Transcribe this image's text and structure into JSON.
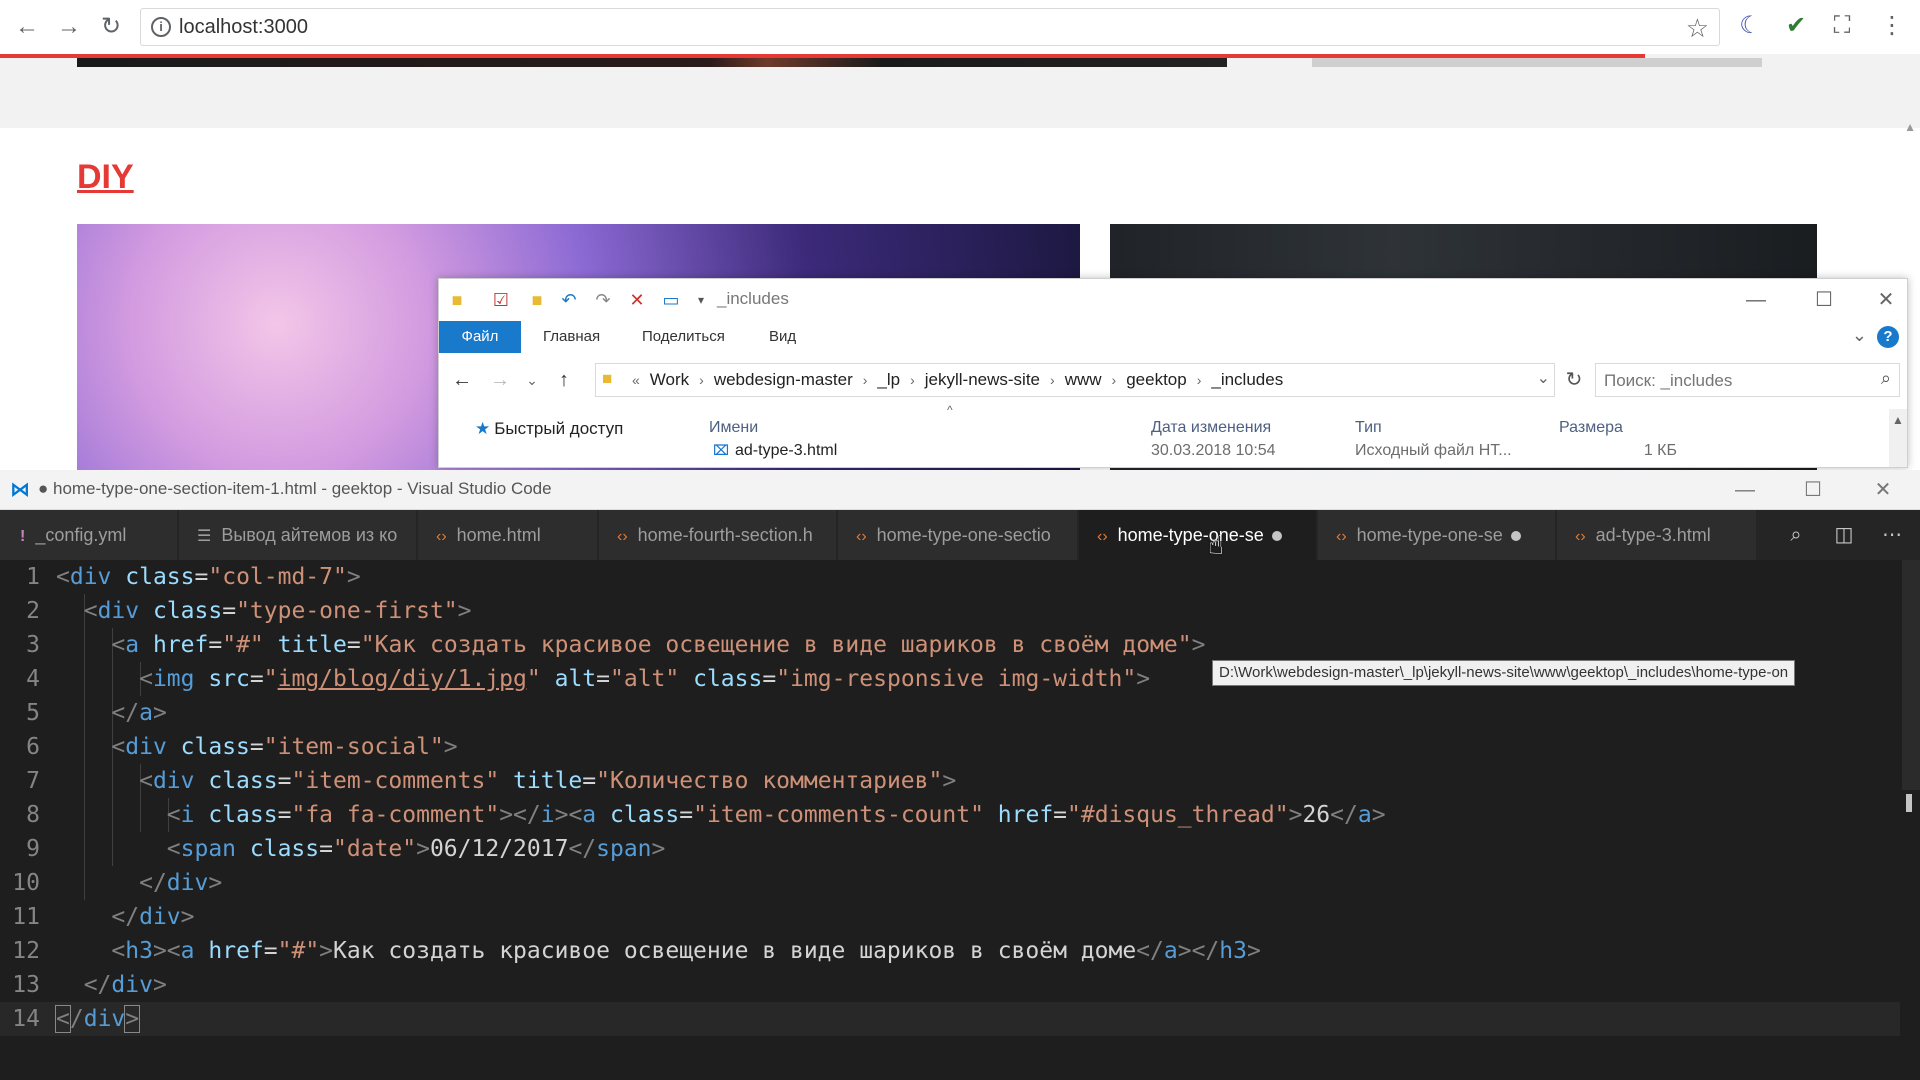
{
  "browser": {
    "url": "localhost:3000",
    "nav": {
      "back": "←",
      "forward": "→",
      "reload": "↻"
    },
    "info_icon": "i",
    "star_icon": "☆",
    "extensions": [
      "moon-icon",
      "vue-icon",
      "fullscreen-icon",
      "menu-icon"
    ],
    "page": {
      "section_title": "DIY"
    },
    "colors": {
      "accent": "#e53935"
    }
  },
  "explorer": {
    "title": "_includes",
    "ribbon_tabs": [
      "Файл",
      "Главная",
      "Поделиться",
      "Вид"
    ],
    "breadcrumbs": [
      "Work",
      "webdesign-master",
      "_lp",
      "jekyll-news-site",
      "www",
      "geektop",
      "_includes"
    ],
    "search_placeholder": "Поиск: _includes",
    "nav_item": "Быстрый доступ",
    "columns": [
      "Имени",
      "Дата изменения",
      "Тип",
      "Размера"
    ],
    "rows": [
      {
        "name": "ad-type-3.html",
        "modified": "30.03.2018 10:54",
        "type": "Исходный файл НТ...",
        "size": "1 КБ"
      }
    ],
    "colors": {
      "accent": "#1979ca"
    }
  },
  "vscode": {
    "title": "● home-type-one-section-item-1.html - geektop - Visual Studio Code",
    "tabs": [
      {
        "label": "_config.yml",
        "icon": "yaml-icon",
        "active": false,
        "dirty": false
      },
      {
        "label": "Вывод айтемов из ко",
        "icon": "markdown-icon",
        "active": false,
        "dirty": false
      },
      {
        "label": "home.html",
        "icon": "html-icon",
        "active": false,
        "dirty": false
      },
      {
        "label": "home-fourth-section.h",
        "icon": "html-icon",
        "active": false,
        "dirty": false
      },
      {
        "label": "home-type-one-sectio",
        "icon": "html-icon",
        "active": false,
        "dirty": false
      },
      {
        "label": "home-type-one-se",
        "icon": "html-icon",
        "active": true,
        "dirty": true
      },
      {
        "label": "home-type-one-se",
        "icon": "html-icon",
        "active": false,
        "dirty": true
      },
      {
        "label": "ad-type-3.html",
        "icon": "html-icon",
        "active": false,
        "dirty": false
      }
    ],
    "tooltip": "D:\\Work\\webdesign-master\\_lp\\jekyll-news-site\\www\\geektop\\_includes\\home-type-on",
    "line_numbers": [
      "1",
      "2",
      "3",
      "4",
      "5",
      "6",
      "7",
      "8",
      "9",
      "10",
      "11",
      "12",
      "13",
      "14"
    ],
    "code": {
      "l3_title": "Как создать красивое освещение в виде шариков в своём доме",
      "l4_src": "img/blog/diy/1.jpg",
      "l7_title": "Количество комментариев",
      "l8_count": "26",
      "l9_date": "06/12/2017",
      "l12_text": "Как создать красивое освещение в виде шариков в своём доме"
    },
    "colors": {
      "tag": "#569cd6",
      "attr": "#9cdcfe",
      "string": "#ce9178",
      "text": "#d4d4d4"
    }
  }
}
